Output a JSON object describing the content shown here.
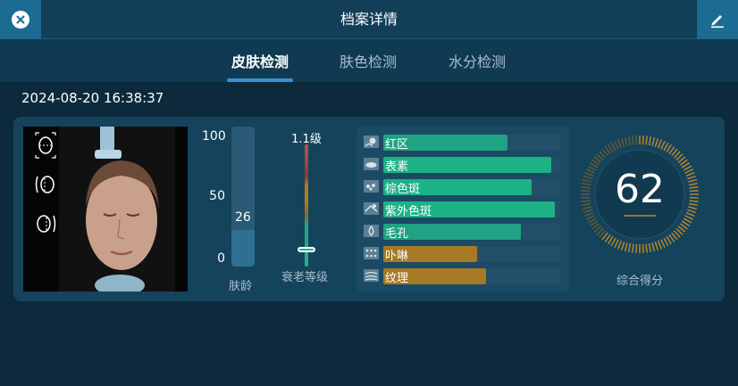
{
  "header": {
    "title": "档案详情",
    "close_icon": "close-icon",
    "edit_icon": "pencil-icon"
  },
  "tabs": [
    {
      "label": "皮肤检测",
      "active": true
    },
    {
      "label": "肤色检测",
      "active": false
    },
    {
      "label": "水分检测",
      "active": false
    }
  ],
  "record": {
    "datetime": "2024-08-20 16:38:37"
  },
  "skin_age": {
    "scale_labels": [
      "100",
      "50",
      "0"
    ],
    "value": "26",
    "value_fraction": 0.26,
    "caption": "肤龄"
  },
  "aging_level": {
    "value": "1.1级",
    "caption": "衰老等级",
    "level_fraction": 0.14
  },
  "metrics": [
    {
      "label": "红区",
      "fill": 0.7,
      "color": "#1fa384",
      "icon": "red-area-icon"
    },
    {
      "label": "表素",
      "fill": 0.95,
      "color": "#1cb284",
      "icon": "surface-icon"
    },
    {
      "label": "棕色斑",
      "fill": 0.84,
      "color": "#1cb284",
      "icon": "brown-spot-icon"
    },
    {
      "label": "紫外色斑",
      "fill": 0.97,
      "color": "#1cb284",
      "icon": "uv-spot-icon"
    },
    {
      "label": "毛孔",
      "fill": 0.78,
      "color": "#1fa384",
      "icon": "pore-icon"
    },
    {
      "label": "卟啉",
      "fill": 0.53,
      "color": "#a67a25",
      "icon": "porphyrin-icon"
    },
    {
      "label": "纹理",
      "fill": 0.58,
      "color": "#a67a25",
      "icon": "texture-icon"
    }
  ],
  "score": {
    "value": "62",
    "caption": "综合得分",
    "fraction": 0.62
  },
  "colors": {
    "accent": "#3a8fd6",
    "header": "#123e58",
    "background": "#0c2a3c",
    "good": "#1cb284",
    "warn": "#a67a25"
  }
}
